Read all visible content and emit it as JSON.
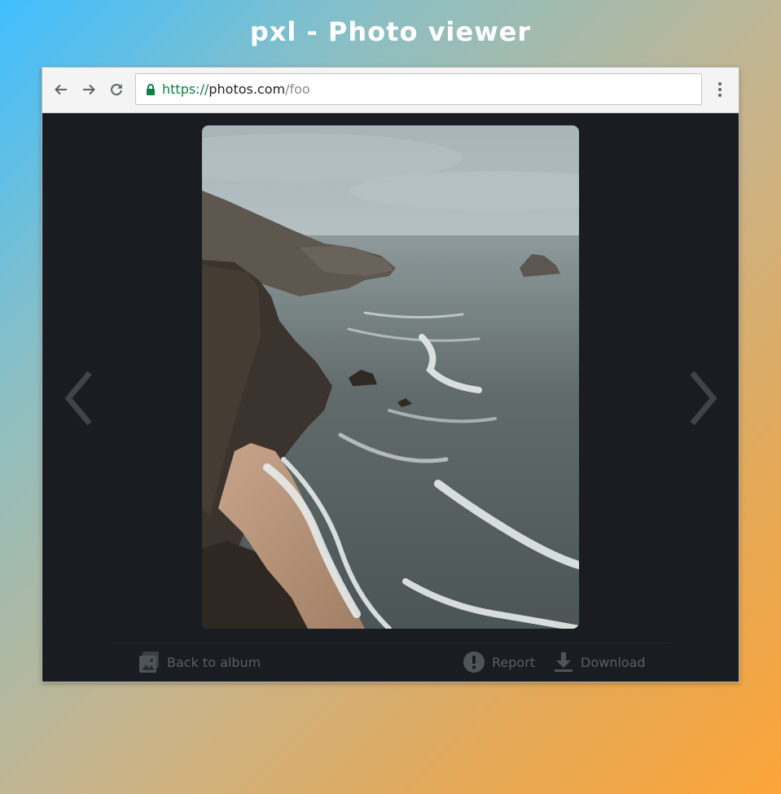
{
  "page": {
    "title": "pxl - Photo viewer"
  },
  "browser": {
    "url": {
      "scheme": "https://",
      "host": "photos.com",
      "path": "/foo"
    }
  },
  "viewer": {
    "image_alt": "Rocky coastline with waves",
    "prev_icon": "chevron-left-icon",
    "next_icon": "chevron-right-icon"
  },
  "actions": {
    "back_label": "Back to album",
    "report_label": "Report",
    "download_label": "Download"
  },
  "colors": {
    "viewer_bg": "#191d21",
    "action_text": "#5a5f64",
    "secure_scheme": "#0b8043"
  }
}
